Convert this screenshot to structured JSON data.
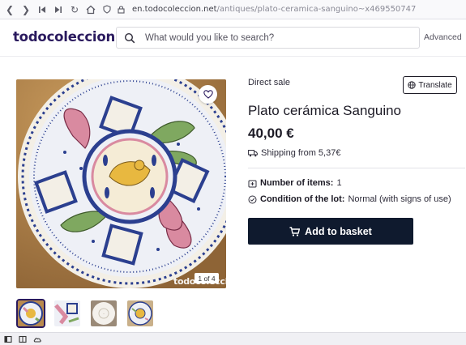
{
  "browser": {
    "url_domain": "en.todocoleccion.net",
    "url_path": "/antiques/plato-ceramica-sanguino~x469550747"
  },
  "header": {
    "logo": "todocoleccion",
    "search_placeholder": "What would you like to search?",
    "advanced_label": "Advanced"
  },
  "gallery": {
    "counter": "1 of 4",
    "watermark": "todocoleccion",
    "thumbnails": [
      "thumbnail-1",
      "thumbnail-2",
      "thumbnail-3",
      "thumbnail-4"
    ]
  },
  "product": {
    "sale_type": "Direct sale",
    "translate_label": "Translate",
    "title": "Plato cerámica Sanguino",
    "price": "40,00 €",
    "shipping": "Shipping from 5,37€",
    "items_label": "Number of items:",
    "items_value": "1",
    "condition_label": "Condition of the lot:",
    "condition_value": "Normal (with signs of use)",
    "basket_label": "Add to basket"
  },
  "colors": {
    "brand": "#2a1a5e",
    "button": "#0f1a2e",
    "plate_blue": "#2b3f8f"
  }
}
